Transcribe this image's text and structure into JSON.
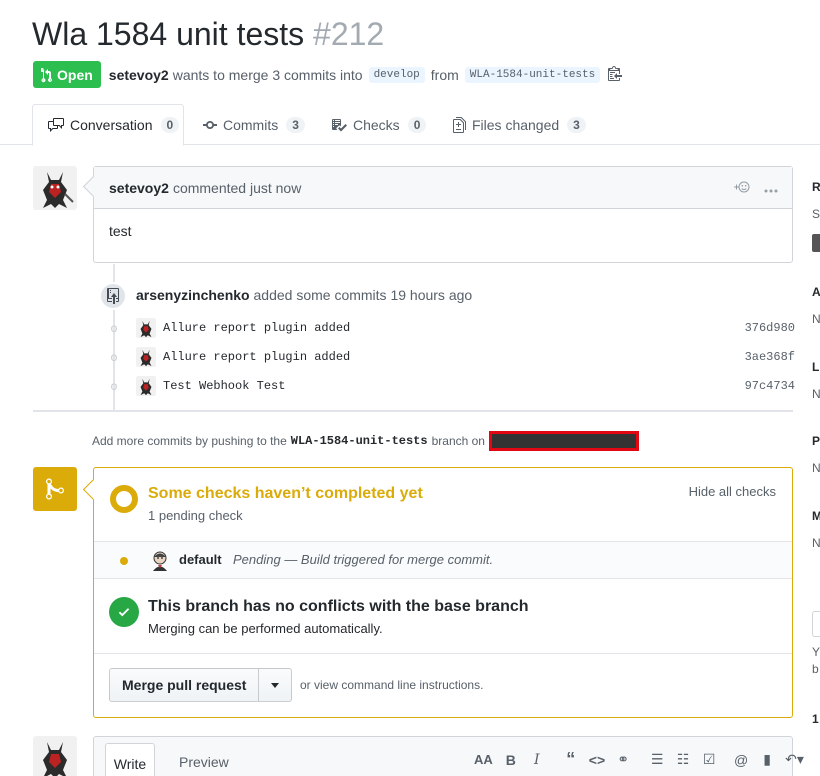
{
  "pr": {
    "title": "Wla 1584 unit tests",
    "number": "#212",
    "state": "Open",
    "author": "setevoy2",
    "merge_text_1": "wants to merge 3 commits into",
    "base_branch": "develop",
    "merge_text_2": "from",
    "head_branch": "WLA-1584-unit-tests"
  },
  "tabs": [
    {
      "label": "Conversation",
      "count": "0",
      "icon": "comment-discussion-icon"
    },
    {
      "label": "Commits",
      "count": "3",
      "icon": "git-commit-icon"
    },
    {
      "label": "Checks",
      "count": "0",
      "icon": "checklist-icon"
    },
    {
      "label": "Files changed",
      "count": "3",
      "icon": "diff-icon"
    }
  ],
  "comment": {
    "author": "setevoy2",
    "action": "commented just now",
    "body": "test"
  },
  "push_event": {
    "author": "arsenyzinchenko",
    "action": "added some commits 19 hours ago",
    "commits": [
      {
        "message": "Allure report plugin added",
        "sha": "376d980"
      },
      {
        "message": "Allure report plugin added",
        "sha": "3ae368f"
      },
      {
        "message": "Test Webhook Test",
        "sha": "97c4734"
      }
    ]
  },
  "hint": {
    "prefix": "Add more commits by pushing to the",
    "branch": "WLA-1584-unit-tests",
    "suffix": "branch on"
  },
  "merge": {
    "checks_title": "Some checks haven’t completed yet",
    "checks_sub": "1 pending check",
    "hide_label": "Hide all checks",
    "check_name": "default",
    "check_desc": "Pending — Build triggered for merge commit.",
    "conflict_title": "This branch has no conflicts with the base branch",
    "conflict_sub": "Merging can be performed automatically.",
    "button_label": "Merge pull request",
    "alt_prefix": "or view",
    "alt_link": "command line instructions."
  },
  "sidebar_peek": {
    "r": "R",
    "s": "S",
    "a": "A",
    "n1": "N",
    "l": "L",
    "n2": "N",
    "p": "P",
    "n3": "N",
    "m": "M",
    "n4": "N",
    "y": "Y",
    "b": "b",
    "one": "1"
  },
  "editor": {
    "write_tab": "Write",
    "preview_tab": "Preview",
    "toolbar": [
      "AA",
      "B",
      "I",
      "“",
      "<>",
      "link",
      "ul",
      "ol",
      "task",
      "@",
      "bookmark",
      "reply"
    ]
  },
  "colors": {
    "open_green": "#2cbe4e",
    "pending_yellow": "#dbab09",
    "success_green": "#28a745",
    "redaction_red": "#e30613"
  }
}
